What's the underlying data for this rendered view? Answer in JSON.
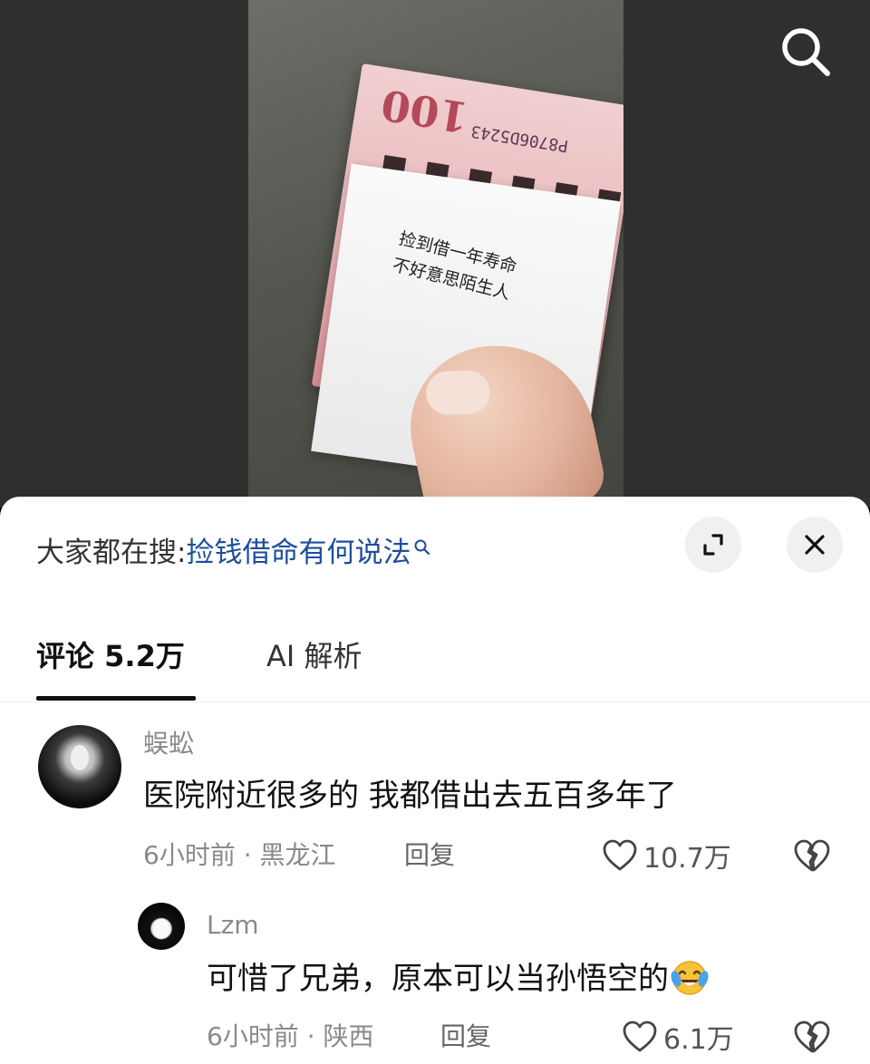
{
  "video": {
    "banknote_text": "100",
    "banknote_serial": "P8706D5243",
    "note_lines": [
      "捡到借一年寿命",
      "不好意思陌生人"
    ]
  },
  "search_bar": {
    "prefix": "大家都在搜:",
    "query": "捡钱借命有何说法"
  },
  "tabs": [
    {
      "label": "评论 5.2万",
      "active": true
    },
    {
      "label": "AI 解析",
      "active": false
    }
  ],
  "comments": [
    {
      "user": "蜈蚣",
      "text": "医院附近很多的 我都借出去五百多年了",
      "time_location": "6小时前 · 黑龙江",
      "reply_label": "回复",
      "likes": "10.7万"
    },
    {
      "user": "Lzm",
      "text": "可惜了兄弟，原本可以当孙悟空的",
      "time_location": "6小时前 · 陕西",
      "reply_label": "回复",
      "likes": "6.1万"
    }
  ],
  "colors": {
    "query_link": "#1e4e9e",
    "muted_text": "#8a8a8a",
    "emoji_face": "#f6c23a",
    "emoji_tear": "#4aa3ea"
  }
}
